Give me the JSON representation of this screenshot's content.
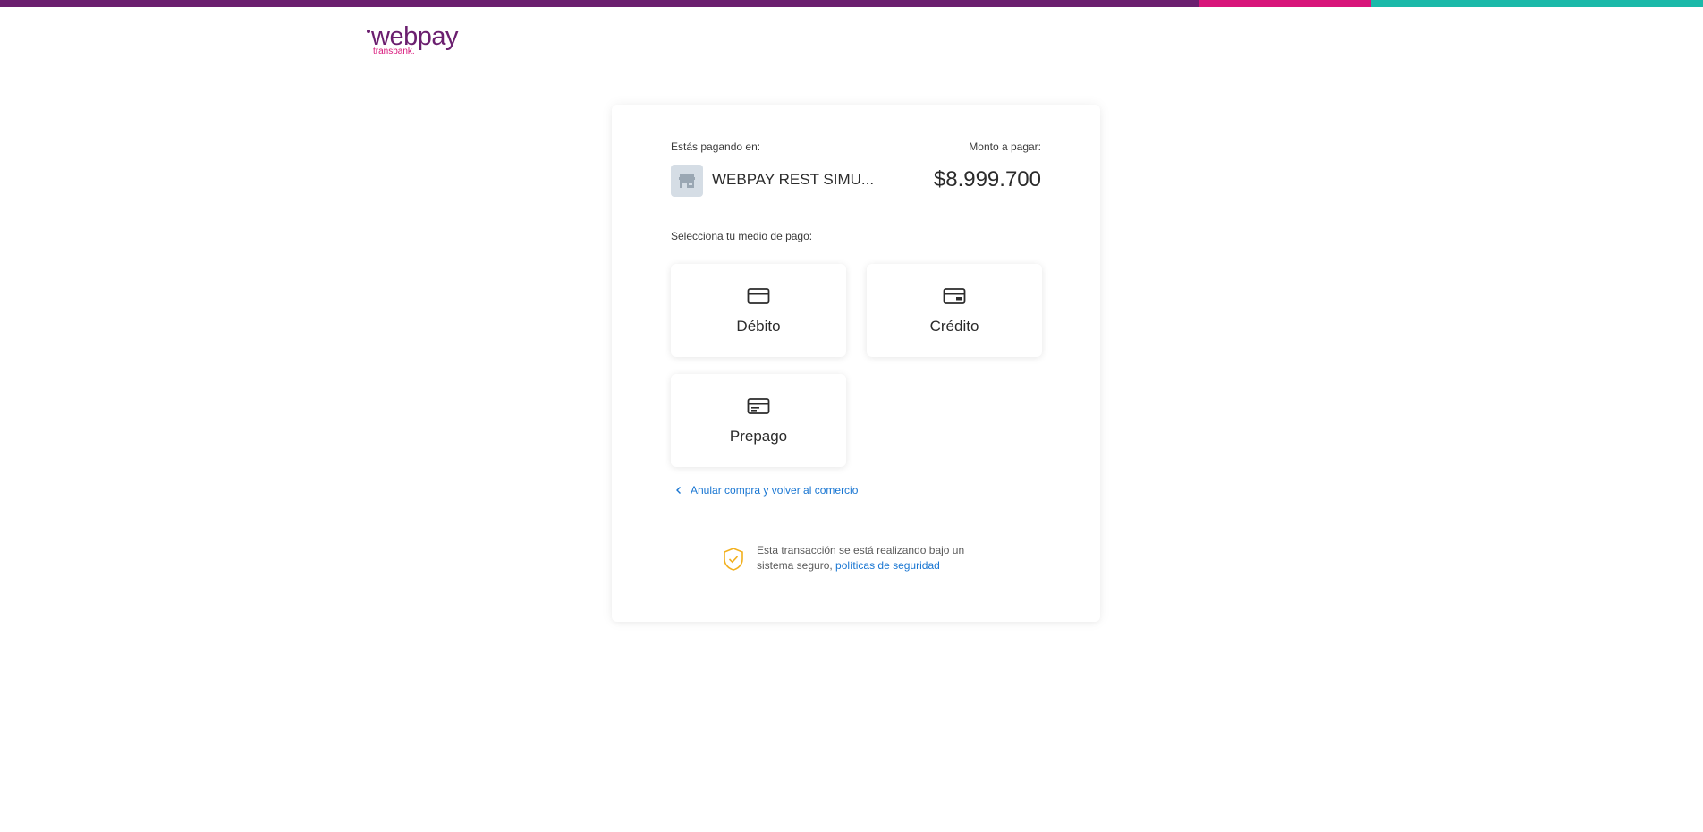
{
  "brand": {
    "logo_text": "webpay",
    "logo_sub": "transbank.",
    "colors": {
      "purple": "#6b1f6f",
      "pink": "#d8157a",
      "teal": "#1bb9a9",
      "link": "#1976d2"
    }
  },
  "payment": {
    "paying_at_label": "Estás pagando en:",
    "merchant_name": "WEBPAY REST SIMU...",
    "merchant_icon": "store-icon",
    "amount_label": "Monto a pagar:",
    "amount": "$8.999.700",
    "select_method_label": "Selecciona tu medio de pago:",
    "methods": [
      {
        "label": "Débito",
        "icon": "credit-card-icon"
      },
      {
        "label": "Crédito",
        "icon": "credit-card-chip-icon"
      },
      {
        "label": "Prepago",
        "icon": "prepaid-card-icon"
      }
    ],
    "cancel_link": "Anular compra y volver al comercio",
    "security_text": "Esta transacción se está realizando bajo un sistema seguro,",
    "security_link": "políticas de seguridad"
  }
}
